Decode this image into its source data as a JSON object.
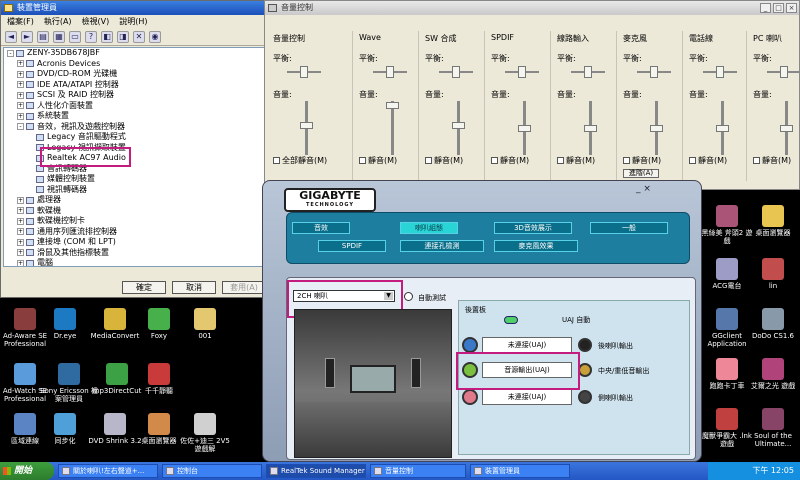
{
  "device_manager": {
    "title": "裝置管理員",
    "menus": [
      "檔案(F)",
      "執行(A)",
      "檢視(V)",
      "說明(H)"
    ],
    "tree": [
      {
        "label": "ZENY-35DB678JBF",
        "depth": 0,
        "exp": "-"
      },
      {
        "label": "Acronis Devices",
        "depth": 1,
        "exp": "+"
      },
      {
        "label": "DVD/CD-ROM 光碟機",
        "depth": 1,
        "exp": "+"
      },
      {
        "label": "IDE ATA/ATAPI 控制器",
        "depth": 1,
        "exp": "+"
      },
      {
        "label": "SCSI 及 RAID 控制器",
        "depth": 1,
        "exp": "+"
      },
      {
        "label": "人性化介面裝置",
        "depth": 1,
        "exp": "+"
      },
      {
        "label": "系統裝置",
        "depth": 1,
        "exp": "+"
      },
      {
        "label": "音效，視訊及遊戲控制器",
        "depth": 1,
        "exp": "-"
      },
      {
        "label": "Legacy 音訊驅動程式",
        "depth": 2,
        "exp": ""
      },
      {
        "label": "Legacy 視訊擷取裝置",
        "depth": 2,
        "exp": ""
      },
      {
        "label": "Realtek AC97 Audio",
        "depth": 2,
        "exp": ""
      },
      {
        "label": "音訊轉碼器",
        "depth": 2,
        "exp": ""
      },
      {
        "label": "媒體控制裝置",
        "depth": 2,
        "exp": ""
      },
      {
        "label": "視訊轉碼器",
        "depth": 2,
        "exp": ""
      },
      {
        "label": "處理器",
        "depth": 1,
        "exp": "+"
      },
      {
        "label": "軟碟機",
        "depth": 1,
        "exp": "+"
      },
      {
        "label": "軟碟機控制卡",
        "depth": 1,
        "exp": "+"
      },
      {
        "label": "通用序列匯流排控制器",
        "depth": 1,
        "exp": "+"
      },
      {
        "label": "連接埠 (COM 和 LPT)",
        "depth": 1,
        "exp": "+"
      },
      {
        "label": "滑鼠及其他指標裝置",
        "depth": 1,
        "exp": "+"
      },
      {
        "label": "電腦",
        "depth": 1,
        "exp": "+"
      }
    ],
    "buttons": {
      "ok": "確定",
      "cancel": "取消",
      "apply": "套用(A)"
    }
  },
  "mixer": {
    "title": "音量控制",
    "balance_label": "平衡:",
    "volume_label": "音量:",
    "advanced_label": "進階(A)",
    "channels": [
      {
        "name": "音量控制",
        "mute": "全部靜音(M)",
        "vol": 0.55,
        "bal": 0.5
      },
      {
        "name": "Wave",
        "mute": "靜音(M)",
        "vol": 0.92,
        "bal": 0.5
      },
      {
        "name": "SW 合成",
        "mute": "靜音(M)",
        "vol": 0.55,
        "bal": 0.5
      },
      {
        "name": "SPDIF",
        "mute": "靜音(M)",
        "vol": 0.5,
        "bal": 0.5
      },
      {
        "name": "線路輸入",
        "mute": "靜音(M)",
        "vol": 0.5,
        "bal": 0.5
      },
      {
        "name": "麥克風",
        "mute": "靜音(M)",
        "vol": 0.5,
        "bal": 0.5
      },
      {
        "name": "電話線",
        "mute": "靜音(M)",
        "vol": 0.5,
        "bal": 0.5
      },
      {
        "name": "PC 喇叭",
        "mute": "靜音(M)",
        "vol": 0.5,
        "bal": 0.5
      }
    ]
  },
  "gigabyte": {
    "logo_main": "GIGABYTE",
    "logo_sub": "TECHNOLOGY",
    "tabs_row1": [
      "音效",
      "喇叭組態",
      "3D音效展示",
      "一般"
    ],
    "tabs_row2": [
      "SPDIF",
      "連接孔檢測",
      "麥克風效果"
    ],
    "active_tab": "喇叭組態",
    "speaker_select": "2CH 喇叭",
    "auto_test": "自動測試",
    "back_panel": "後置板",
    "uaj_auto": "UAJ 自動",
    "jacks": [
      {
        "box": "未連接(UAJ)",
        "right": "後喇叭輸出",
        "color": "#3a78c8"
      },
      {
        "box": "音源輸出(UAJ)",
        "right": "中央/重低音輸出",
        "color": "#7bbf3f"
      },
      {
        "box": "未連接(UAJ)",
        "right": "側喇叭輸出",
        "color": "#e07a8a"
      }
    ],
    "ctrl_glyph": "_ ×"
  },
  "desktop_icons": [
    {
      "label": "Ad-Aware SE Professional",
      "color": "#8a3d3d"
    },
    {
      "label": "Dr.eye",
      "color": "#1b7ac2"
    },
    {
      "label": "MediaConvert",
      "color": "#d9b43a"
    },
    {
      "label": "Foxy",
      "color": "#48b04a"
    },
    {
      "label": "001",
      "color": "#e4c870"
    },
    {
      "label": "Ad-Watch SE Professional",
      "color": "#5a9bdc"
    },
    {
      "label": "Sony Ericsson 檔案管理員",
      "color": "#2f6aa0"
    },
    {
      "label": "mp3DirectCut",
      "color": "#3ca045"
    },
    {
      "label": "千千靜聽",
      "color": "#c93a3a"
    },
    {
      "label": "區域連線",
      "color": "#5b84c4"
    },
    {
      "label": "同步化",
      "color": "#4fa0d8"
    },
    {
      "label": "DVD Shrink 3.2",
      "color": "#b7b7c9"
    },
    {
      "label": "桌面瀏覽器",
      "color": "#d28a4a"
    },
    {
      "label": "佐佐+迪三 2V5 遊戲解",
      "color": "#d0d0d0"
    }
  ],
  "right_icons": [
    {
      "label": "黑絲美 斧頭2 遊戲",
      "color": "#aa5577"
    },
    {
      "label": "桌面瀏覽器",
      "color": "#e8c450"
    },
    {
      "label": "ACG電台",
      "color": "#9c9cc7"
    },
    {
      "label": "lin",
      "color": "#c24d4d"
    },
    {
      "label": "GGclient Application",
      "color": "#5577aa"
    },
    {
      "label": "DoDo CS1.6",
      "color": "#8899aa"
    },
    {
      "label": "跑跑卡丁車",
      "color": "#ee8899"
    },
    {
      "label": "艾爾之光 遊戲",
      "color": "#b0447a"
    },
    {
      "label": "魔獸爭霸大 .lnk 遊戲",
      "color": "#c04040"
    },
    {
      "label": "Soul of the Ultimate...",
      "color": "#884466"
    }
  ],
  "taskbar": {
    "start": "開始",
    "tasks": [
      "關於喇叭!左右聲道+...",
      "控制台",
      "RealTek Sound Manager",
      "音量控制",
      "裝置管理員"
    ],
    "active_task": "RealTek Sound Manager",
    "clock": "下午 12:05"
  }
}
